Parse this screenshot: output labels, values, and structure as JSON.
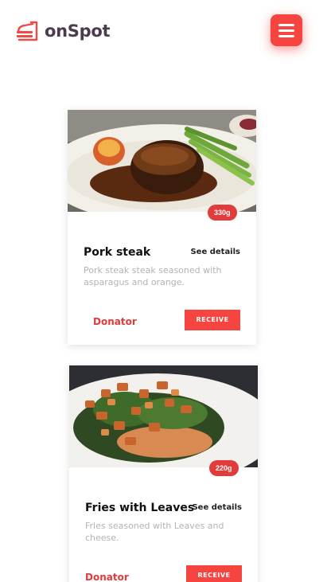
{
  "app": {
    "name": "onSpot"
  },
  "colors": {
    "accent": "#f64440",
    "brand_text": "#4a3b4f",
    "muted_text": "#b3b3b3"
  },
  "header": {
    "logo_icon": "food-tray-icon",
    "menu_icon": "hamburger-menu-icon"
  },
  "cards": [
    {
      "title": "Pork steak",
      "weight": "330g",
      "details_label": "See details",
      "description": "Pork steak steak seasoned with asparagus and orange.",
      "donator_label": "Donator",
      "action_label": "RECEIVE"
    },
    {
      "title": "Fries with Leaves",
      "weight": "220g",
      "details_label": "See details",
      "description": "Fries seasoned with Leaves and cheese.",
      "donator_label": "Donator",
      "action_label": "RECEIVE"
    }
  ]
}
